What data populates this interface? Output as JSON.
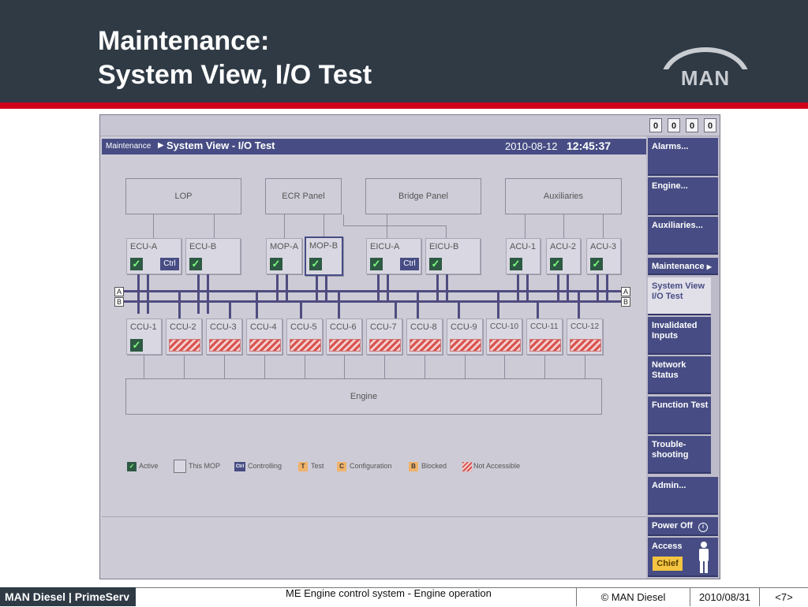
{
  "slide": {
    "title_line1": "Maintenance:",
    "title_line2": "System View, I/O Test",
    "logo_text": "MAN"
  },
  "screen": {
    "counters": [
      "0",
      "0",
      "0",
      "0"
    ],
    "breadcrumb_root": "Maintenance",
    "page_title": "System View - I/O Test",
    "date": "2010-08-12",
    "time": "12:45:37"
  },
  "diagram": {
    "groups": [
      "LOP",
      "ECR Panel",
      "Bridge Panel",
      "Auxiliaries"
    ],
    "engine_label": "Engine",
    "bus_a": "A",
    "bus_b": "B",
    "top_nodes": [
      {
        "label": "ECU-A",
        "active": true,
        "ctrl": "Ctrl"
      },
      {
        "label": "ECU-B",
        "active": true,
        "ctrl": ""
      },
      {
        "label": "MOP-A",
        "active": true,
        "ctrl": ""
      },
      {
        "label": "MOP-B",
        "active": true,
        "ctrl": ""
      },
      {
        "label": "EICU-A",
        "active": true,
        "ctrl": "Ctrl"
      },
      {
        "label": "EICU-B",
        "active": true,
        "ctrl": ""
      },
      {
        "label": "ACU-1",
        "active": true,
        "ctrl": ""
      },
      {
        "label": "ACU-2",
        "active": true,
        "ctrl": ""
      },
      {
        "label": "ACU-3",
        "active": true,
        "ctrl": ""
      }
    ],
    "ccu_nodes": [
      {
        "label": "CCU-1",
        "state": "active"
      },
      {
        "label": "CCU-2",
        "state": "not-accessible"
      },
      {
        "label": "CCU-3",
        "state": "not-accessible"
      },
      {
        "label": "CCU-4",
        "state": "not-accessible"
      },
      {
        "label": "CCU-5",
        "state": "not-accessible"
      },
      {
        "label": "CCU-6",
        "state": "not-accessible"
      },
      {
        "label": "CCU-7",
        "state": "not-accessible"
      },
      {
        "label": "CCU-8",
        "state": "not-accessible"
      },
      {
        "label": "CCU-9",
        "state": "not-accessible"
      },
      {
        "label": "CCU-10",
        "state": "not-accessible"
      },
      {
        "label": "CCU-11",
        "state": "not-accessible"
      },
      {
        "label": "CCU-12",
        "state": "not-accessible"
      }
    ],
    "check_glyph": "✓"
  },
  "legend": {
    "active": "Active",
    "this_mop": "This MOP",
    "ctrl_badge": "Ctrl",
    "controlling": "Controlling",
    "test_badge": "T",
    "test": "Test",
    "config_badge": "C",
    "configuration": "Configuration",
    "blocked_badge": "B",
    "blocked": "Blocked",
    "not_accessible": "Not Accessible"
  },
  "sidebar": {
    "items": [
      {
        "label": "Alarms..."
      },
      {
        "label": "Engine..."
      },
      {
        "label": "Auxiliaries..."
      },
      {
        "label": "Maintenance"
      },
      {
        "label": "System View I/O Test"
      },
      {
        "label": "Invalidated Inputs"
      },
      {
        "label": "Network Status"
      },
      {
        "label": "Function Test"
      },
      {
        "label": "Trouble- shooting"
      },
      {
        "label": "Admin..."
      },
      {
        "label": "Power Off"
      }
    ],
    "access_label": "Access",
    "access_level": "Chief"
  },
  "footer": {
    "brand": "MAN Diesel | PrimeServ",
    "subject": "ME Engine control system - Engine operation",
    "copyright": "© MAN Diesel",
    "date": "2010/08/31",
    "page": "<7>"
  },
  "colors": {
    "header_bg": "#2f3a45",
    "accent_red": "#d0021b",
    "screen_bg": "#cfcdd8",
    "bar_blue": "#474d84",
    "active_green": "#2e5a44"
  }
}
